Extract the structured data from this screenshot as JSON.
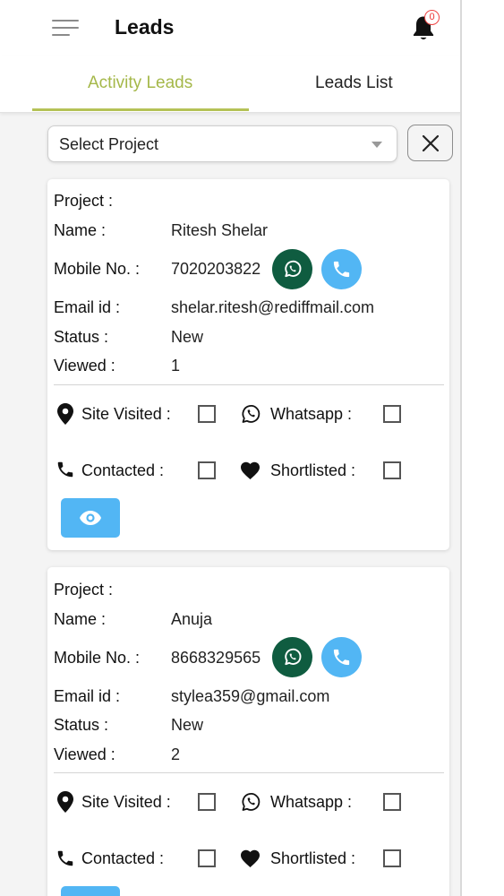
{
  "header": {
    "title": "Leads",
    "notification_count": "0"
  },
  "tabs": [
    {
      "label": "Activity Leads"
    },
    {
      "label": "Leads List"
    }
  ],
  "filter": {
    "select_placeholder": "Select Project"
  },
  "labels": {
    "project": "Project :",
    "name": "Name :",
    "mobile": "Mobile No. :",
    "email": "Email id :",
    "status": "Status :",
    "viewed": "Viewed :",
    "site_visited": "Site Visited :",
    "whatsapp": "Whatsapp :",
    "contacted": "Contacted :",
    "shortlisted": "Shortlisted  :"
  },
  "leads": [
    {
      "project": "",
      "name": "Ritesh Shelar",
      "mobile": "7020203822",
      "email": "shelar.ritesh@rediffmail.com",
      "status": "New",
      "viewed": "1",
      "site_visited": false,
      "whatsapp": false,
      "contacted": false,
      "shortlisted": false
    },
    {
      "project": "",
      "name": "Anuja",
      "mobile": "8668329565",
      "email": "stylea359@gmail.com",
      "status": "New",
      "viewed": "2",
      "site_visited": false,
      "whatsapp": false,
      "contacted": false,
      "shortlisted": false
    }
  ],
  "colors": {
    "accent": "#a5b84a",
    "whatsapp": "#0f5c40",
    "call": "#52b6f4"
  },
  "icons": {
    "menu": "menu-icon",
    "bell": "bell-icon",
    "close": "close-icon",
    "whatsapp": "whatsapp-icon",
    "phone": "phone-icon",
    "location": "location-pin-icon",
    "heart": "heart-icon",
    "eye": "eye-icon"
  }
}
